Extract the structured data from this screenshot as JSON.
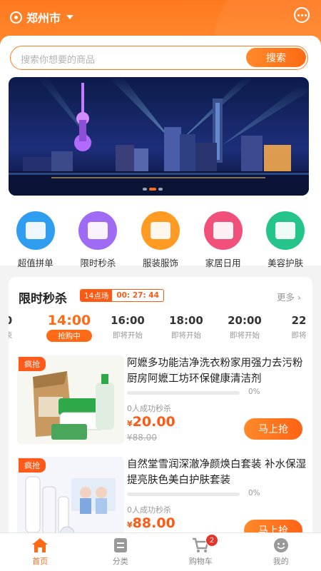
{
  "header": {
    "city": "郑州市",
    "icons": {
      "location": "location-pin-icon",
      "dropdown": "caret-down-icon",
      "message": "chat-bubble-icon"
    }
  },
  "search": {
    "placeholder": "搜索你想要的商品",
    "button": "搜索"
  },
  "banner": {
    "slides": 3,
    "active_slide": 2
  },
  "categories": [
    {
      "label": "超值拼单",
      "icon": "shopping-bag-icon",
      "color": "#2f9df0"
    },
    {
      "label": "限时秒杀",
      "icon": "flash-sale-icon",
      "color": "#9f6bf5"
    },
    {
      "label": "服装服饰",
      "icon": "clothing-box-icon",
      "color": "#ff9b22"
    },
    {
      "label": "家居日用",
      "icon": "sofa-icon",
      "color": "#f0507a"
    },
    {
      "label": "美容护肤",
      "icon": "cosmetics-icon",
      "color": "#25c48a"
    }
  ],
  "flash": {
    "title": "限时秒杀",
    "session": "14点场",
    "countdown": "00: 27: 44",
    "more": "更多",
    "slots": [
      {
        "time": "0",
        "status": "束",
        "active": false
      },
      {
        "time": "14:00",
        "status": "抢购中",
        "active": true
      },
      {
        "time": "16:00",
        "status": "即将开始",
        "active": false
      },
      {
        "time": "18:00",
        "status": "即将开始",
        "active": false
      },
      {
        "time": "20:00",
        "status": "即将开始",
        "active": false
      },
      {
        "time": "22",
        "status": "即将",
        "active": false
      }
    ],
    "items": [
      {
        "badge": "疯抢",
        "name": "阿嬷多功能洁净洗衣粉家用强力去污粉厨房阿嬷工坊环保健康清洁剂",
        "progress": 0,
        "progress_label": "0%",
        "sold": "0人成功秒杀",
        "currency": "¥",
        "price": "20.00",
        "original": "¥88.00",
        "button": "马上抢"
      },
      {
        "badge": "疯抢",
        "name": "自然堂雪润深澈净颜焕白套装 补水保湿提亮肤色美白护肤套装",
        "progress": 0,
        "progress_label": "0%",
        "sold": "0人成功秒杀",
        "currency": "¥",
        "price": "88.00",
        "original": "",
        "button": "马上抢"
      }
    ]
  },
  "tabbar": [
    {
      "label": "首页",
      "icon": "home-icon",
      "active": true
    },
    {
      "label": "分类",
      "icon": "category-icon",
      "active": false
    },
    {
      "label": "购物车",
      "icon": "cart-icon",
      "active": false,
      "badge": "2"
    },
    {
      "label": "我的",
      "icon": "profile-icon",
      "active": false
    }
  ],
  "colors": {
    "accent": "#ff6a16",
    "header": "#ff7a1f",
    "sale_red": "#ff5a14"
  }
}
